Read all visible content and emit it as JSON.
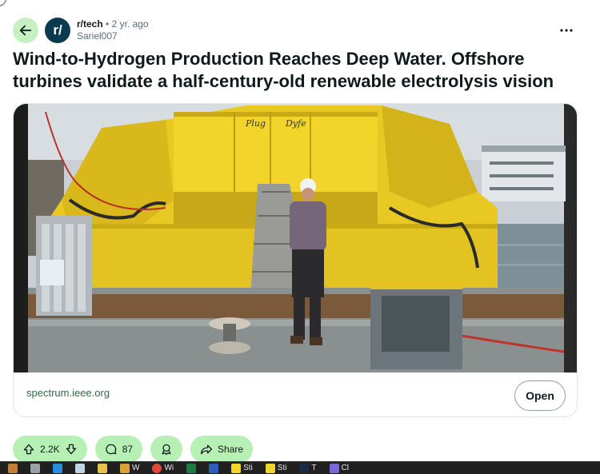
{
  "post": {
    "subreddit": "r/tech",
    "separator": "•",
    "age": "2 yr. ago",
    "author": "Sariel007",
    "subreddit_avatar_text": "r/",
    "title": "Wind-to-Hydrogen Production Reaches Deep Water. Offshore turbines validate a half-century-old renewable electrolysis vision"
  },
  "link_card": {
    "domain": "spectrum.ieee.org",
    "open_label": "Open",
    "image_container_labels": [
      "Plug",
      "Dyfe"
    ]
  },
  "actions": {
    "vote_count": "2.2K",
    "comment_count": "87",
    "share_label": "Share"
  },
  "taskbar": {
    "items": [
      {
        "icon": "tb-weather-icon",
        "label": ""
      },
      {
        "icon": "tb-taskview-icon",
        "label": ""
      },
      {
        "icon": "tb-edge-icon",
        "label": ""
      },
      {
        "icon": "tb-app-icon",
        "label": ""
      },
      {
        "icon": "tb-folder-icon",
        "label": ""
      },
      {
        "icon": "tb-app2-icon",
        "label": "W"
      },
      {
        "icon": "tb-chrome-icon",
        "label": "Wi"
      },
      {
        "icon": "tb-excel-icon",
        "label": ""
      },
      {
        "icon": "tb-word-icon",
        "label": ""
      },
      {
        "icon": "tb-sticky-icon",
        "label": "Sti"
      },
      {
        "icon": "tb-sticky2-icon",
        "label": "Sti"
      },
      {
        "icon": "tb-term-icon",
        "label": "T"
      },
      {
        "icon": "tb-teams-icon",
        "label": "Cl"
      }
    ]
  },
  "colors": {
    "accent_green": "#b7f0b4",
    "back_green": "#c7f0c2",
    "avatar_bg": "#0b3a4e",
    "domain_green": "#2e6b45",
    "container_yellow": "#f2d42a"
  }
}
